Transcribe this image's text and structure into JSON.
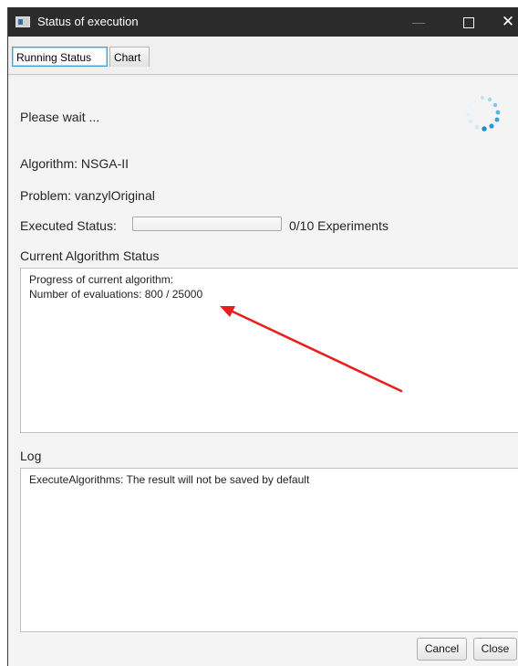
{
  "window": {
    "title": "Status of execution",
    "minimize_symbol": "—",
    "close_symbol": "✕"
  },
  "tabs": [
    {
      "label": "Running Status",
      "selected": true
    },
    {
      "label": "Chart",
      "selected": false
    }
  ],
  "running_status": {
    "wait_message": "Please wait ...",
    "spinner_icon": "loading-spinner-icon",
    "algorithm_line": "Algorithm:  NSGA-II",
    "problem_line": "Problem:  vanzylOriginal",
    "executed_label": "Executed Status:",
    "executed_progress": 0,
    "executed_count": "0/10  Experiments",
    "current_status_label": "Current Algorithm Status",
    "current_status_lines": [
      "Progress of current algorithm:",
      "Number of evaluations: 800 / 25000"
    ],
    "log_label": "Log",
    "log_lines": [
      "ExecuteAlgorithms: The result will not be saved by default"
    ]
  },
  "annotation": {
    "arrow_icon": "red-arrow-annotation",
    "color": "#e8201d"
  },
  "buttons": {
    "cancel": "Cancel",
    "close": "Close"
  },
  "colors": {
    "titlebar": "#2b2b2b",
    "accent": "#3ea2d8",
    "spinner": "#2a98d6"
  }
}
